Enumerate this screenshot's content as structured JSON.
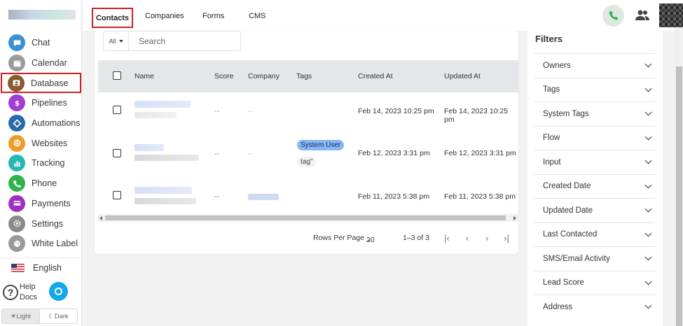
{
  "sidebar": {
    "items": [
      {
        "label": "Chat",
        "icon": "chat-icon",
        "color": "#3b8fd3"
      },
      {
        "label": "Calendar",
        "icon": "calendar-icon",
        "color": "#9b9b9b"
      },
      {
        "label": "Database",
        "icon": "database-icon",
        "color": "#8a5a2e",
        "active": true
      },
      {
        "label": "Pipelines",
        "icon": "pipelines-icon",
        "color": "#a23ed1"
      },
      {
        "label": "Automations",
        "icon": "automations-icon",
        "color": "#2b6aa8"
      },
      {
        "label": "Websites",
        "icon": "websites-icon",
        "color": "#f09c28"
      },
      {
        "label": "Tracking",
        "icon": "tracking-icon",
        "color": "#25b8b0"
      },
      {
        "label": "Phone",
        "icon": "phone-icon",
        "color": "#2fb34a"
      },
      {
        "label": "Payments",
        "icon": "payments-icon",
        "color": "#a02fc0"
      },
      {
        "label": "Settings",
        "icon": "settings-icon",
        "color": "#8a8a8a"
      },
      {
        "label": "White Label",
        "icon": "white-label-icon",
        "color": "#9a9a9a"
      }
    ],
    "language": "English",
    "help_label": "Help Docs",
    "theme_light": "Light",
    "theme_dark": "Dark"
  },
  "topbar": {
    "tabs": [
      "Contacts",
      "Companies",
      "Forms",
      "CMS"
    ]
  },
  "search": {
    "scope": "All",
    "placeholder": "Search"
  },
  "table": {
    "columns": [
      "Name",
      "Score",
      "Company",
      "Tags",
      "Created At",
      "Updated At"
    ],
    "rows": [
      {
        "score": "--",
        "company": "--",
        "tags": [],
        "created": "Feb 14, 2023 10:25 pm",
        "updated": "Feb 14, 2023 10:25 pm"
      },
      {
        "score": "--",
        "company": "--",
        "tags": [
          "System User",
          "tag\""
        ],
        "created": "Feb 12, 2023 3:31 pm",
        "updated": "Feb 12, 2023 3:31 pm"
      },
      {
        "score": "--",
        "company": "",
        "tags": [],
        "created": "Feb 11, 2023 5:38 pm",
        "updated": "Feb 11, 2023 5:38 pm"
      }
    ]
  },
  "pagination": {
    "rows_per_page_label": "Rows Per Page",
    "rows_per_page": "20",
    "range": "1–3 of 3"
  },
  "filters": {
    "title": "Filters",
    "items": [
      "Owners",
      "Tags",
      "System Tags",
      "Flow",
      "Input",
      "Created Date",
      "Updated Date",
      "Last Contacted",
      "SMS/Email Activity",
      "Lead Score",
      "Address"
    ]
  },
  "colors": {
    "accent_red": "#cf2027",
    "tag_blue": "#86b7f8",
    "phone_green": "#2fb34a"
  }
}
